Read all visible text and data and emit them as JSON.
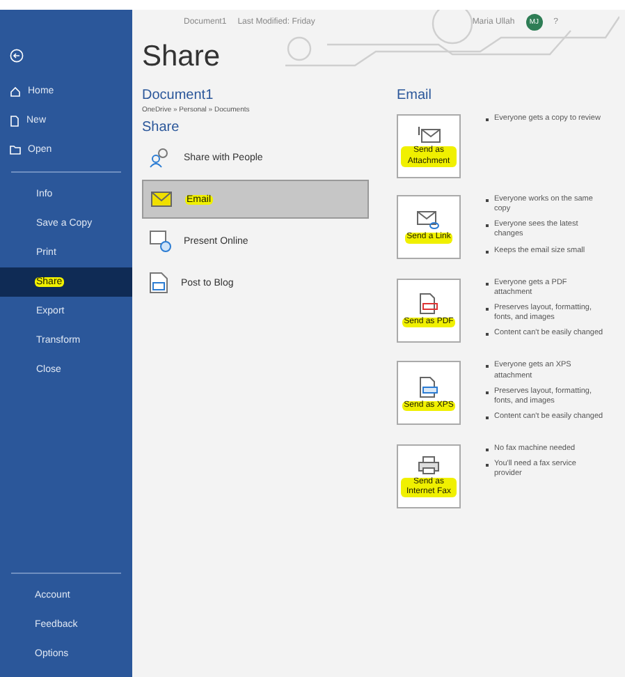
{
  "title_bar": {
    "document": "Document1",
    "modified": "Last Modified: Friday",
    "user": "Maria Ullah",
    "avatar": "MJ",
    "help": "?"
  },
  "sidebar": {
    "top": [
      {
        "label": "Home",
        "kind": "home"
      },
      {
        "label": "New",
        "kind": "new"
      },
      {
        "label": "Open",
        "kind": "open"
      }
    ],
    "items": [
      {
        "label": "Info",
        "selected": false
      },
      {
        "label": "Save a Copy",
        "selected": false
      },
      {
        "label": "Print",
        "selected": false
      },
      {
        "label": "Share",
        "selected": true,
        "highlighted": true
      },
      {
        "label": "Export",
        "selected": false
      },
      {
        "label": "Transform",
        "selected": false
      },
      {
        "label": "Close",
        "selected": false
      }
    ],
    "bottom": [
      {
        "label": "Account"
      },
      {
        "label": "Feedback"
      },
      {
        "label": "Options"
      }
    ]
  },
  "page_title": "Share",
  "document": {
    "name": "Document1",
    "path": "OneDrive » Personal » Documents"
  },
  "share": {
    "heading": "Share",
    "options": [
      {
        "label": "Share with People",
        "kind": "people",
        "selected": false
      },
      {
        "label": "Email",
        "kind": "email",
        "selected": true,
        "highlighted": true
      },
      {
        "label": "Present Online",
        "kind": "present",
        "selected": false
      },
      {
        "label": "Post to Blog",
        "kind": "blog",
        "selected": false
      }
    ]
  },
  "email": {
    "heading": "Email",
    "actions": [
      {
        "label": "Send as Attachment",
        "kind": "attach",
        "highlighted": true,
        "notes": [
          "Everyone gets a copy to review"
        ]
      },
      {
        "label": "Send a Link",
        "kind": "link",
        "highlighted": true,
        "notes": [
          "Everyone works on the same copy",
          "Everyone sees the latest changes",
          "Keeps the email size small"
        ]
      },
      {
        "label": "Send as PDF",
        "kind": "pdf",
        "highlighted": true,
        "notes": [
          "Everyone gets a PDF attachment",
          "Preserves layout, formatting, fonts, and images",
          "Content can't be easily changed"
        ]
      },
      {
        "label": "Send as XPS",
        "kind": "xps",
        "highlighted": true,
        "notes": [
          "Everyone gets an XPS attachment",
          "Preserves layout, formatting, fonts, and images",
          "Content can't be easily changed"
        ]
      },
      {
        "label": "Send as Internet Fax",
        "kind": "fax",
        "highlighted": true,
        "notes": [
          "No fax machine needed",
          "You'll need a fax service provider"
        ]
      }
    ]
  }
}
